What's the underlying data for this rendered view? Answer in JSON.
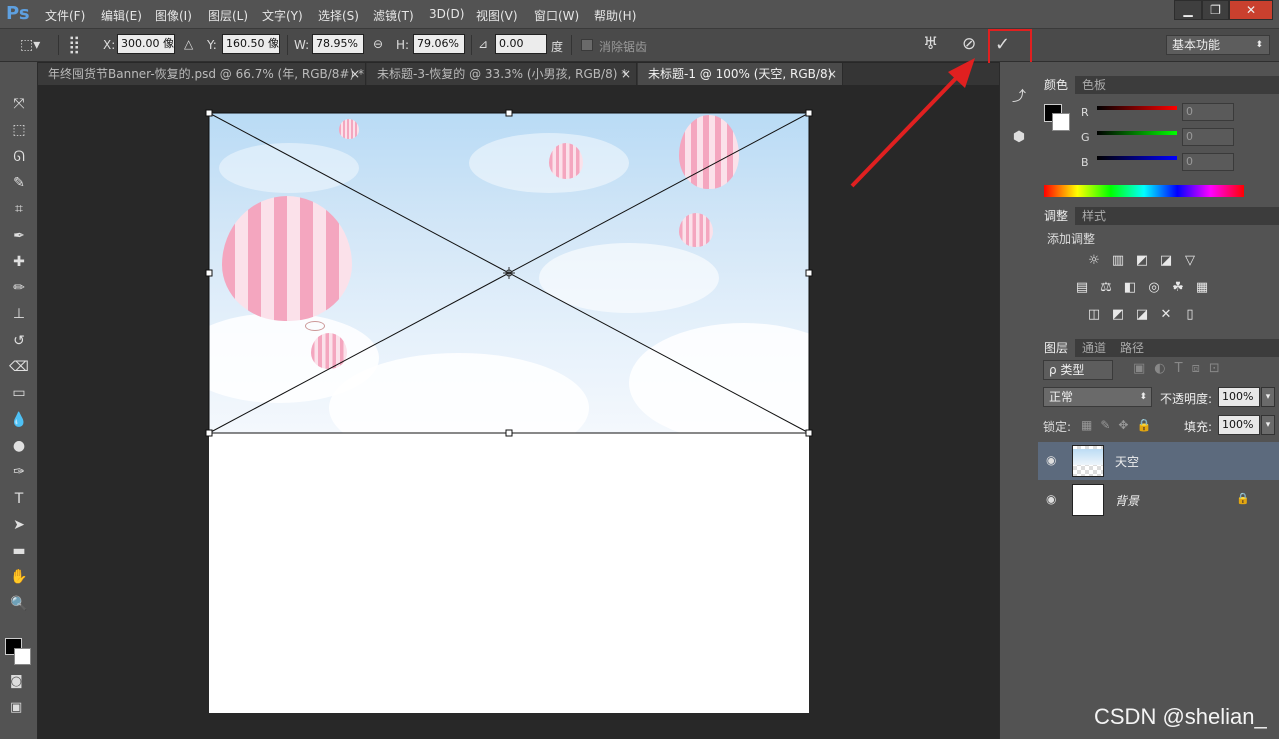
{
  "app": {
    "logo": "Ps"
  },
  "menu": [
    "文件(F)",
    "编辑(E)",
    "图像(I)",
    "图层(L)",
    "文字(Y)",
    "选择(S)",
    "滤镜(T)",
    "3D(D)",
    "视图(V)",
    "窗口(W)",
    "帮助(H)"
  ],
  "window_controls": {
    "minimize": "▁",
    "restore": "❐",
    "close": "✕"
  },
  "options": {
    "x_label": "X:",
    "x_value": "300.00 像",
    "y_label": "Y:",
    "y_value": "160.50 像",
    "w_label": "W:",
    "w_value": "78.95%",
    "h_label": "H:",
    "h_value": "79.06%",
    "angle_value": "0.00",
    "angle_unit": "度",
    "antialias_label": "消除锯齿",
    "workspace": "基本功能",
    "cancel_icon": "⊘",
    "commit_icon": "✓",
    "warp_icon": "♅"
  },
  "tabs": [
    {
      "label": "年终囤货节Banner-恢复的.psd @ 66.7% (年, RGB/8#) *",
      "close": "×"
    },
    {
      "label": "未标题-3-恢复的 @ 33.3% (小男孩, RGB/8) *",
      "close": "×"
    },
    {
      "label": "未标题-1 @ 100% (天空, RGB/8)",
      "close": "×"
    }
  ],
  "tools": [
    "move-tool",
    "marquee-tool",
    "lasso-tool",
    "quick-select-tool",
    "crop-tool",
    "eyedropper-tool",
    "healing-brush-tool",
    "brush-tool",
    "stamp-tool",
    "history-brush-tool",
    "eraser-tool",
    "gradient-tool",
    "blur-tool",
    "dodge-tool",
    "pen-tool",
    "type-tool",
    "path-select-tool",
    "shape-tool",
    "hand-tool",
    "zoom-tool"
  ],
  "tool_glyphs": [
    "⤧",
    "⬚",
    "ᘏ",
    "✎",
    "⌗",
    "✒",
    "✚",
    "✏",
    "⊥",
    "↺",
    "⌫",
    "▭",
    "💧",
    "●",
    "✑",
    "T",
    "➤",
    "▬",
    "✋",
    "🔍"
  ],
  "color_panel": {
    "tab_color": "颜色",
    "tab_swatches": "色板",
    "r_label": "R",
    "g_label": "G",
    "b_label": "B",
    "r_value": "0",
    "g_value": "0",
    "b_value": "0"
  },
  "adjust_panel": {
    "tab_adjust": "调整",
    "tab_styles": "样式",
    "add_label": "添加调整",
    "icons_row1": [
      "☼",
      "▥",
      "◩",
      "◪",
      "▽"
    ],
    "icons_row2": [
      "▤",
      "⚖",
      "◧",
      "◎",
      "☘",
      "▦"
    ],
    "icons_row3": [
      "◫",
      "◩",
      "◪",
      "✕",
      "▯"
    ]
  },
  "layers_panel": {
    "tab_layers": "图层",
    "tab_channels": "通道",
    "tab_paths": "路径",
    "filter_label": "ρ 类型",
    "blend_mode": "正常",
    "opacity_label": "不透明度:",
    "opacity_value": "100%",
    "lock_label": "锁定:",
    "fill_label": "填充:",
    "fill_value": "100%",
    "layers": [
      {
        "name": "天空",
        "visible": true,
        "selected": true
      },
      {
        "name": "背景",
        "visible": true,
        "selected": false,
        "locked": true
      }
    ],
    "eye_icon": "👁",
    "lock_icon": "🔒"
  },
  "watermark": "CSDN @shelian_",
  "colors": {
    "accent_red": "#e02020",
    "selected_layer": "#5c6a7d"
  }
}
